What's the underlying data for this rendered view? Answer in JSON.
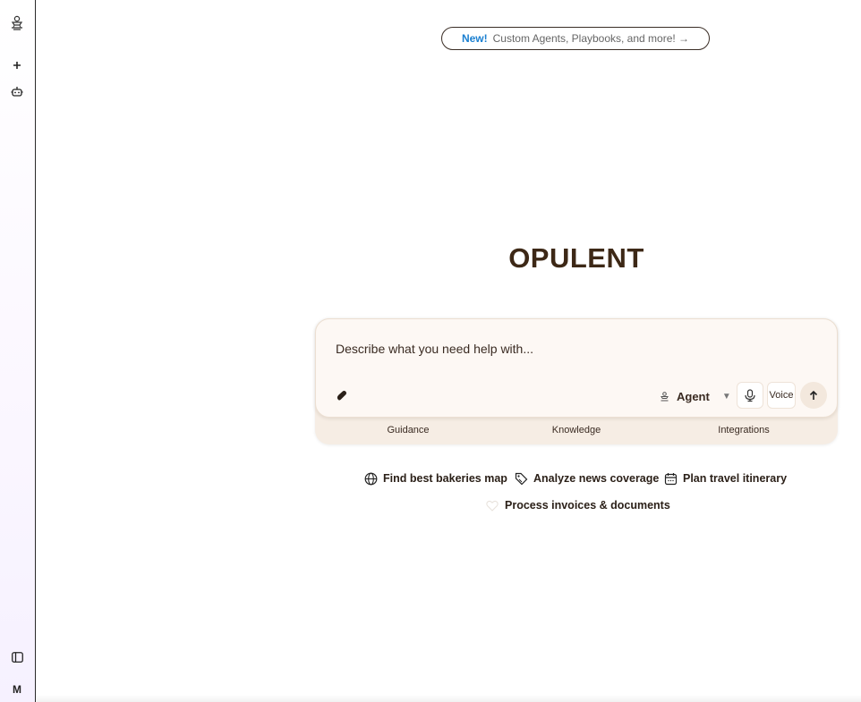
{
  "sidebar": {
    "logo_icon": "opulent-logo-icon",
    "new_icon": "plus-icon",
    "agents_icon": "robot-icon",
    "panel_icon": "sidebar-toggle-icon",
    "avatar_initial": "M"
  },
  "announcement": {
    "badge": "New!",
    "text": "Custom Agents, Playbooks, and more! →"
  },
  "brand": {
    "title": "OPULENT"
  },
  "prompt": {
    "placeholder": "Describe what you need help with...",
    "attach_icon": "paperclip-icon",
    "mode_label": "Agent",
    "mode_icon": "agent-icon",
    "mic_icon": "microphone-icon",
    "voice_label": "Voice",
    "send_icon": "arrow-up-icon"
  },
  "prompt_tabs": [
    "Guidance",
    "Knowledge",
    "Integrations"
  ],
  "suggestions": [
    {
      "label": "Find best bakeries map",
      "icon": "globe-icon"
    },
    {
      "label": "Analyze news coverage",
      "icon": "tag-icon"
    },
    {
      "label": "Plan travel itinerary",
      "icon": "calendar-icon"
    },
    {
      "label": "Process invoices & documents",
      "icon": "heart-icon"
    }
  ],
  "colors": {
    "brand_text": "#3d2816",
    "prompt_bg": "#fdf8f4",
    "tab_bar_bg": "#f6ede4",
    "announce_badge": "#1a7fd0"
  }
}
